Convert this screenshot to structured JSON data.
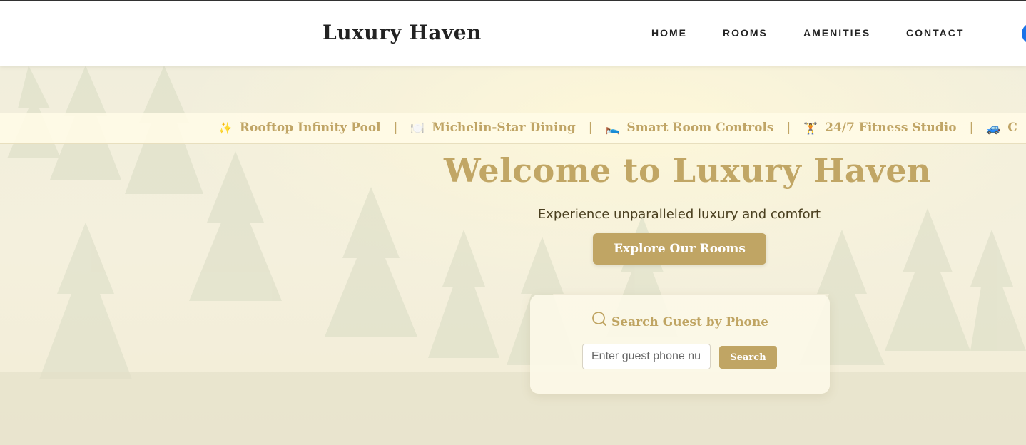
{
  "header": {
    "logo": "Luxury Haven",
    "nav": [
      "HOME",
      "ROOMS",
      "AMENITIES",
      "CONTACT"
    ]
  },
  "ticker": {
    "items": [
      {
        "icon": "✨",
        "icon_name": "sparkles-icon",
        "label": "Rooftop Infinity Pool"
      },
      {
        "icon": "🍽️",
        "icon_name": "plate-cutlery-icon",
        "label": "Michelin-Star Dining"
      },
      {
        "icon": "🛌",
        "icon_name": "bed-icon",
        "label": "Smart Room Controls"
      },
      {
        "icon": "🏋️",
        "icon_name": "weightlifter-icon",
        "label": "24/7 Fitness Studio"
      },
      {
        "icon": "🚙",
        "icon_name": "car-icon",
        "label": "C"
      }
    ],
    "separator": "|"
  },
  "hero": {
    "title": "Welcome to Luxury Haven",
    "subtitle": "Experience unparalleled luxury and comfort",
    "cta_label": "Explore Our Rooms"
  },
  "search": {
    "title": "Search Guest by Phone",
    "input_placeholder": "Enter guest phone number",
    "button_label": "Search"
  },
  "colors": {
    "accent_gold": "#c0a564",
    "ticker_bg": "#fffbe6",
    "header_bg": "#ffffff",
    "text_dark": "#222222"
  }
}
